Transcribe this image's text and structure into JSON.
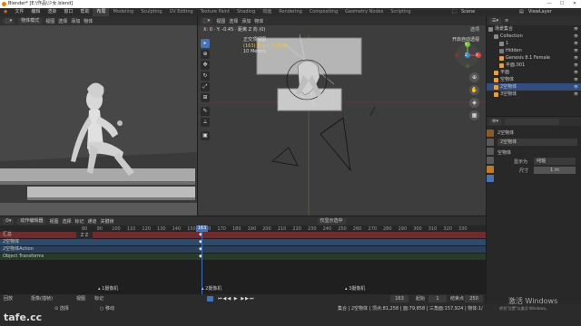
{
  "window": {
    "title": "Blender* [E:\\作品\\少女.blend]",
    "min": "—",
    "max": "☐",
    "close": "✕"
  },
  "menu": [
    "文件",
    "编辑",
    "渲染",
    "窗口",
    "帮助"
  ],
  "workspaces": [
    {
      "label": "布局",
      "active": true
    },
    {
      "label": "Modeling",
      "active": false
    },
    {
      "label": "Sculpting",
      "active": false
    },
    {
      "label": "UV Editing",
      "active": false
    },
    {
      "label": "Texture Paint",
      "active": false
    },
    {
      "label": "Shading",
      "active": false
    },
    {
      "label": "动画",
      "active": false
    },
    {
      "label": "Rendering",
      "active": false
    },
    {
      "label": "Compositing",
      "active": false
    },
    {
      "label": "Geometry Nodes",
      "active": false
    },
    {
      "label": "Scripting",
      "active": false
    }
  ],
  "top_right": {
    "scene": "Scene",
    "view_layer": "ViewLayer"
  },
  "left_viewport": {
    "header_items": [
      "物体模式",
      "视图",
      "选择",
      "添加",
      "物体"
    ]
  },
  "right_viewport": {
    "header_items": [
      "视图",
      "选择",
      "添加",
      "物体"
    ],
    "coord_readout": "X: 0 · Y: -0.45 · 距离 Z 向 (0)",
    "options_label": "选项",
    "overlay_title": "正交顶视图",
    "overlay_sub": "(163) 集合 | 2空物体",
    "overlay_scale": "10 Meters",
    "gizmo_note": "开启自动透视",
    "axes": {
      "x": "X",
      "y": "Y",
      "z": "Z"
    }
  },
  "outliner": {
    "header_label": "≡",
    "rows": [
      {
        "label": "场景集合",
        "indent": 0,
        "color": "#8a8a8a",
        "selected": false
      },
      {
        "label": "Collection",
        "indent": 1,
        "color": "#8a8a8a",
        "selected": false
      },
      {
        "label": "1",
        "indent": 2,
        "color": "#8a8a8a",
        "selected": false
      },
      {
        "label": "Hidden",
        "indent": 2,
        "color": "#7a7a7a",
        "selected": false
      },
      {
        "label": "Genesis 8.1 Female",
        "indent": 2,
        "color": "#e0a050",
        "selected": false
      },
      {
        "label": "平面.001",
        "indent": 2,
        "color": "#e0a050",
        "selected": false
      },
      {
        "label": "平面",
        "indent": 1,
        "color": "#e0a050",
        "selected": false
      },
      {
        "label": "空物体",
        "indent": 1,
        "color": "#e0a050",
        "selected": false
      },
      {
        "label": "2空物体",
        "indent": 1,
        "color": "#e0a050",
        "selected": true
      },
      {
        "label": "3空物体",
        "indent": 1,
        "color": "#e0a050",
        "selected": false
      }
    ]
  },
  "properties": {
    "object_name": "2空物体",
    "panel_title": "空物体",
    "display_as_label": "显示为",
    "display_as_value": "纯轴",
    "size_label": "尺寸",
    "size_value": "1 m"
  },
  "timeline": {
    "header_items": [
      "摄影表",
      "视图",
      "选择",
      "标记",
      "通道",
      "关键帧"
    ],
    "mode_label": "动作编辑器",
    "summary_label": "仅显示选中",
    "current_frame": "163",
    "ticks": [
      "80",
      "90",
      "100",
      "110",
      "120",
      "130",
      "140",
      "150",
      "160",
      "170",
      "180",
      "190",
      "200",
      "210",
      "220",
      "230",
      "240",
      "250",
      "260",
      "270",
      "280",
      "290",
      "300",
      "310",
      "320",
      "330"
    ],
    "tracks": [
      {
        "label": "汇总",
        "color": "#6b2d2d"
      },
      {
        "label": "2空物体",
        "color": "#2f4a66"
      },
      {
        "label": "2空物体Action",
        "color": "#2d3f56"
      },
      {
        "label": "Object Transforms",
        "color": "#2a3a2a"
      }
    ],
    "markers": [
      "1摄像机",
      "2摄像机",
      "3摄像机"
    ]
  },
  "playback": {
    "items": [
      "回放",
      "抠像(插帧)",
      "视图",
      "标记"
    ],
    "frame_current": "163",
    "start_label": "起始",
    "start_value": "1",
    "end_label": "结束点",
    "end_value": "250"
  },
  "status": {
    "left": "⊙ 选择",
    "hint": "○ 移动",
    "info": "集合 | 2空物体 | 顶点:81,258 | 面:79,858 | 三角面:157,924 | 物体:1/3 | 3.0.0",
    "watermark_main": "激活 Windows",
    "watermark_sub": "转到\"设置\"以激活 Windows。",
    "site_logo": "tafe.cc"
  }
}
